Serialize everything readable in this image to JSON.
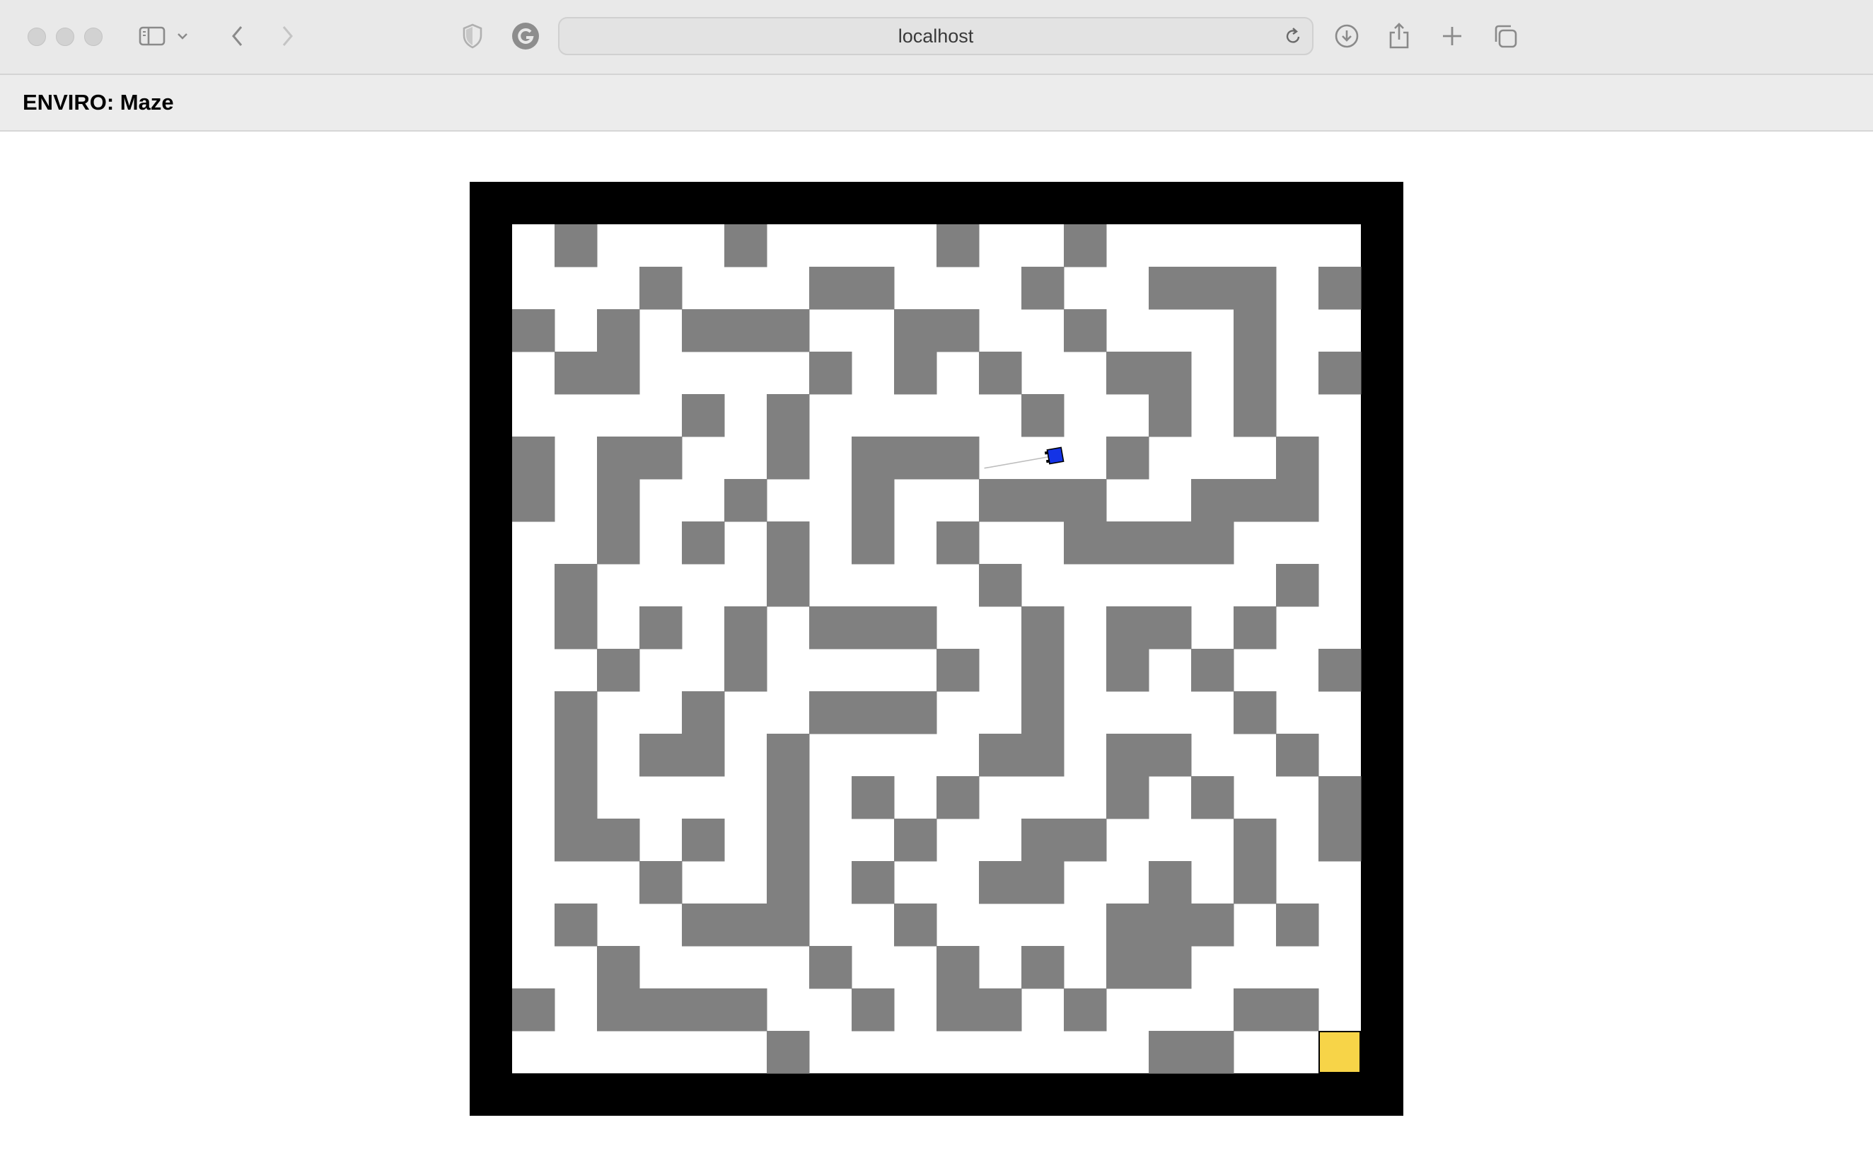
{
  "browser": {
    "address": "localhost",
    "icons": [
      "close-dot",
      "minimize-dot",
      "zoom-dot",
      "sidebar-icon",
      "chevron-down-icon",
      "back-icon",
      "forward-icon",
      "shield-icon",
      "extension-icon",
      "reload-icon",
      "download-icon",
      "share-icon",
      "new-tab-icon",
      "tabs-icon"
    ]
  },
  "app": {
    "title": "ENVIRO: Maze"
  },
  "maze": {
    "rows": 20,
    "cols": 20,
    "colors": {
      "border": "#000000",
      "floor": "#ffffff",
      "wall": "#808080",
      "goal": "#f7d448",
      "agent": "#1433e6"
    },
    "walls": [
      [
        0,
        1
      ],
      [
        0,
        5
      ],
      [
        0,
        10
      ],
      [
        0,
        13
      ],
      [
        1,
        3
      ],
      [
        1,
        7
      ],
      [
        1,
        8
      ],
      [
        1,
        12
      ],
      [
        1,
        15
      ],
      [
        1,
        16
      ],
      [
        1,
        17
      ],
      [
        1,
        19
      ],
      [
        2,
        0
      ],
      [
        2,
        2
      ],
      [
        2,
        4
      ],
      [
        2,
        5
      ],
      [
        2,
        6
      ],
      [
        2,
        9
      ],
      [
        2,
        10
      ],
      [
        2,
        13
      ],
      [
        2,
        17
      ],
      [
        3,
        1
      ],
      [
        3,
        2
      ],
      [
        3,
        7
      ],
      [
        3,
        9
      ],
      [
        3,
        11
      ],
      [
        3,
        14
      ],
      [
        3,
        15
      ],
      [
        3,
        17
      ],
      [
        3,
        19
      ],
      [
        4,
        4
      ],
      [
        4,
        6
      ],
      [
        4,
        12
      ],
      [
        4,
        15
      ],
      [
        4,
        17
      ],
      [
        5,
        0
      ],
      [
        5,
        2
      ],
      [
        5,
        3
      ],
      [
        5,
        6
      ],
      [
        5,
        8
      ],
      [
        5,
        9
      ],
      [
        5,
        10
      ],
      [
        5,
        14
      ],
      [
        5,
        18
      ],
      [
        6,
        0
      ],
      [
        6,
        2
      ],
      [
        6,
        5
      ],
      [
        6,
        8
      ],
      [
        6,
        11
      ],
      [
        6,
        12
      ],
      [
        6,
        13
      ],
      [
        6,
        16
      ],
      [
        6,
        17
      ],
      [
        6,
        18
      ],
      [
        7,
        2
      ],
      [
        7,
        4
      ],
      [
        7,
        6
      ],
      [
        7,
        8
      ],
      [
        7,
        10
      ],
      [
        7,
        13
      ],
      [
        7,
        14
      ],
      [
        7,
        15
      ],
      [
        7,
        16
      ],
      [
        8,
        1
      ],
      [
        8,
        6
      ],
      [
        8,
        11
      ],
      [
        8,
        18
      ],
      [
        9,
        1
      ],
      [
        9,
        3
      ],
      [
        9,
        5
      ],
      [
        9,
        7
      ],
      [
        9,
        8
      ],
      [
        9,
        9
      ],
      [
        9,
        12
      ],
      [
        9,
        14
      ],
      [
        9,
        15
      ],
      [
        9,
        17
      ],
      [
        10,
        2
      ],
      [
        10,
        5
      ],
      [
        10,
        10
      ],
      [
        10,
        12
      ],
      [
        10,
        14
      ],
      [
        10,
        16
      ],
      [
        10,
        19
      ],
      [
        11,
        1
      ],
      [
        11,
        4
      ],
      [
        11,
        7
      ],
      [
        11,
        8
      ],
      [
        11,
        9
      ],
      [
        11,
        12
      ],
      [
        11,
        17
      ],
      [
        12,
        1
      ],
      [
        12,
        3
      ],
      [
        12,
        4
      ],
      [
        12,
        6
      ],
      [
        12,
        11
      ],
      [
        12,
        12
      ],
      [
        12,
        14
      ],
      [
        12,
        15
      ],
      [
        12,
        18
      ],
      [
        13,
        1
      ],
      [
        13,
        6
      ],
      [
        13,
        8
      ],
      [
        13,
        10
      ],
      [
        13,
        14
      ],
      [
        13,
        16
      ],
      [
        13,
        19
      ],
      [
        14,
        1
      ],
      [
        14,
        2
      ],
      [
        14,
        4
      ],
      [
        14,
        6
      ],
      [
        14,
        9
      ],
      [
        14,
        12
      ],
      [
        14,
        13
      ],
      [
        14,
        17
      ],
      [
        14,
        19
      ],
      [
        15,
        3
      ],
      [
        15,
        6
      ],
      [
        15,
        8
      ],
      [
        15,
        11
      ],
      [
        15,
        12
      ],
      [
        15,
        15
      ],
      [
        15,
        17
      ],
      [
        16,
        1
      ],
      [
        16,
        4
      ],
      [
        16,
        5
      ],
      [
        16,
        6
      ],
      [
        16,
        9
      ],
      [
        16,
        14
      ],
      [
        16,
        15
      ],
      [
        16,
        16
      ],
      [
        16,
        18
      ],
      [
        17,
        2
      ],
      [
        17,
        7
      ],
      [
        17,
        10
      ],
      [
        17,
        12
      ],
      [
        17,
        14
      ],
      [
        17,
        15
      ],
      [
        18,
        0
      ],
      [
        18,
        2
      ],
      [
        18,
        3
      ],
      [
        18,
        4
      ],
      [
        18,
        5
      ],
      [
        18,
        8
      ],
      [
        18,
        10
      ],
      [
        18,
        11
      ],
      [
        18,
        13
      ],
      [
        18,
        17
      ],
      [
        18,
        18
      ],
      [
        19,
        6
      ],
      [
        19,
        15
      ],
      [
        19,
        16
      ]
    ],
    "goal": {
      "row": 19,
      "col": 19
    },
    "agent": {
      "x": 12.8,
      "y": 5.45,
      "heading_deg": -10,
      "trail_length": 1.7
    }
  }
}
